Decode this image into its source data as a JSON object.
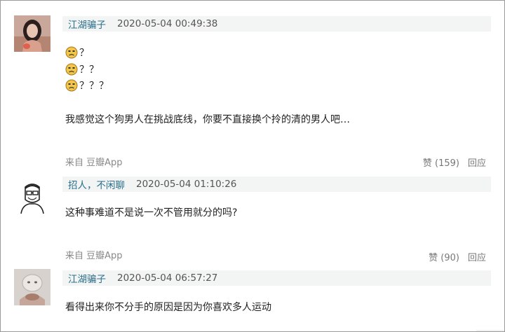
{
  "comments": [
    {
      "author": "江湖骗子",
      "time": "2020-05-04 00:49:38",
      "emoji_lines": [
        "？",
        "？？",
        "？？？"
      ],
      "text": "我感觉这个狗男人在挑战底线，你要不直接换个拎的清的男人吧…",
      "source": "来自 豆瓣App",
      "like_label": "赞 (159)",
      "reply_label": "回应"
    },
    {
      "author": "招人，不闲聊",
      "time": "2020-05-04 01:10:26",
      "text": "这种事难道不是说一次不管用就分的吗?",
      "source": "来自 豆瓣App",
      "like_label": "赞 (90)",
      "reply_label": "回应"
    },
    {
      "author": "江湖骗子",
      "time": "2020-05-04 06:57:27",
      "text": "看得出来你不分手的原因是因为你喜欢多人运动"
    }
  ],
  "icons": {
    "emoji": "sad-face-emoji-icon"
  }
}
